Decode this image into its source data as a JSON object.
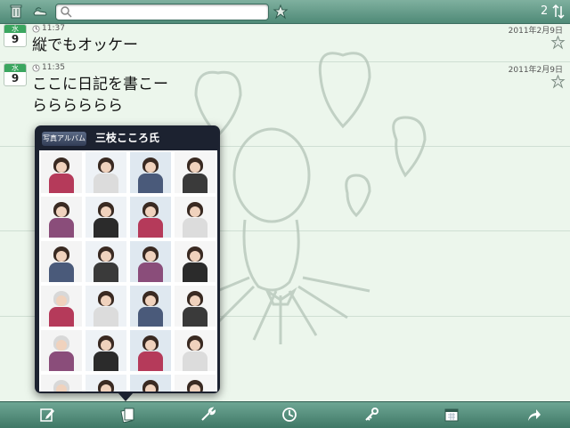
{
  "topbar": {
    "trash_icon": "trash-icon",
    "shoes_icon": "shoes-icon",
    "search": {
      "value": "",
      "placeholder": ""
    },
    "count": "2",
    "sort_icon": "sort-arrows-icon"
  },
  "entries": [
    {
      "weekday": "水",
      "day": "9",
      "time": "11:37",
      "date": "2011年2月9日",
      "text": "縦でもオッケー"
    },
    {
      "weekday": "水",
      "day": "9",
      "time": "11:35",
      "date": "2011年2月9日",
      "text": "ここに日記を書こー\nらららららら"
    }
  ],
  "popover": {
    "album_button": "写真アルバム",
    "title": "三枝こころ氏",
    "photo_count": 24
  },
  "toolbar": {
    "icons": [
      "pencil-icon",
      "notes-icon",
      "wrench-icon",
      "clock-icon",
      "key-icon",
      "calendar-icon",
      "share-arrow-icon"
    ]
  },
  "colors": {
    "accent": "#4f8a77",
    "weekday": "#3aa65f",
    "popover": "#1c2230"
  }
}
